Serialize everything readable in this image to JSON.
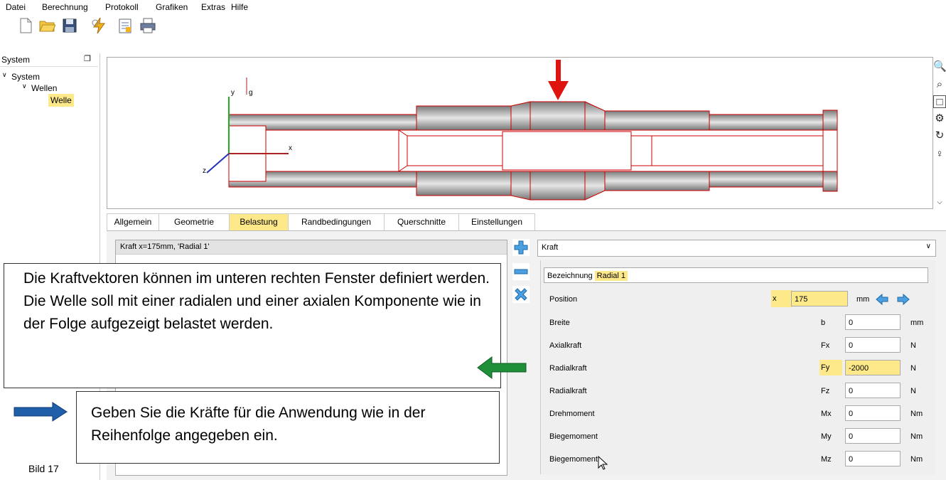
{
  "menu": [
    "Datei",
    "Berechnung",
    "Protokoll",
    "Grafiken",
    "Extras",
    "Hilfe"
  ],
  "toolbar": {
    "icons": [
      "new-file-icon",
      "open-folder-icon",
      "save-icon",
      "calculate-icon",
      "report-icon",
      "print-icon"
    ]
  },
  "tree": {
    "header": "System",
    "items": [
      "System",
      "Wellen",
      "Welle"
    ]
  },
  "view": {
    "axis_labels": {
      "y": "y",
      "g": "g",
      "x": "x",
      "z": "z"
    },
    "side_icons": [
      "zoom-in-icon",
      "zoom-out-icon",
      "zoom-window-icon",
      "settings-gear-icon",
      "rotate-icon",
      "light-icon",
      "more-icon"
    ]
  },
  "tabs": [
    "Allgemein",
    "Geometrie",
    "Belastung",
    "Randbedingungen",
    "Querschnitte",
    "Einstellungen"
  ],
  "load_list": {
    "items": [
      "Kraft  x=175mm, 'Radial 1'"
    ]
  },
  "right_panel": {
    "type_select": "Kraft",
    "bezeichnung_label": "Bezeichnung",
    "bezeichnung_value": "Radial 1",
    "rows": [
      {
        "label": "Position",
        "symbol": "x",
        "value": "175",
        "unit": "mm"
      },
      {
        "label": "Breite",
        "symbol": "b",
        "value": "0",
        "unit": "mm"
      },
      {
        "label": "Axialkraft",
        "symbol": "Fx",
        "value": "0",
        "unit": "N"
      },
      {
        "label": "Radialkraft",
        "symbol": "Fy",
        "value": "-2000",
        "unit": "N"
      },
      {
        "label": "Radialkraft",
        "symbol": "Fz",
        "value": "0",
        "unit": "N"
      },
      {
        "label": "Drehmoment",
        "symbol": "Mx",
        "value": "0",
        "unit": "Nm"
      },
      {
        "label": "Biegemoment",
        "symbol": "My",
        "value": "0",
        "unit": "Nm"
      },
      {
        "label": "Biegemoment",
        "symbol": "Mz",
        "value": "0",
        "unit": "Nm"
      }
    ]
  },
  "callouts": {
    "top": "Die Kraftvektoren können im unteren rechten Fenster definiert werden. Die Welle soll mit einer radialen und einer axialen Komponente wie in der Folge aufgezeigt belastet werden.",
    "bottom": "Geben Sie die Kräfte für die Anwendung wie in der Reihenfolge angegeben ein."
  },
  "caption": "Bild 17",
  "colors": {
    "highlight": "#fde98a",
    "shaft_outline": "#cc0000",
    "force_arrow": "#e0140f",
    "callout_arrow_green": "#1f8f3a",
    "callout_arrow_blue": "#1f5faa"
  }
}
